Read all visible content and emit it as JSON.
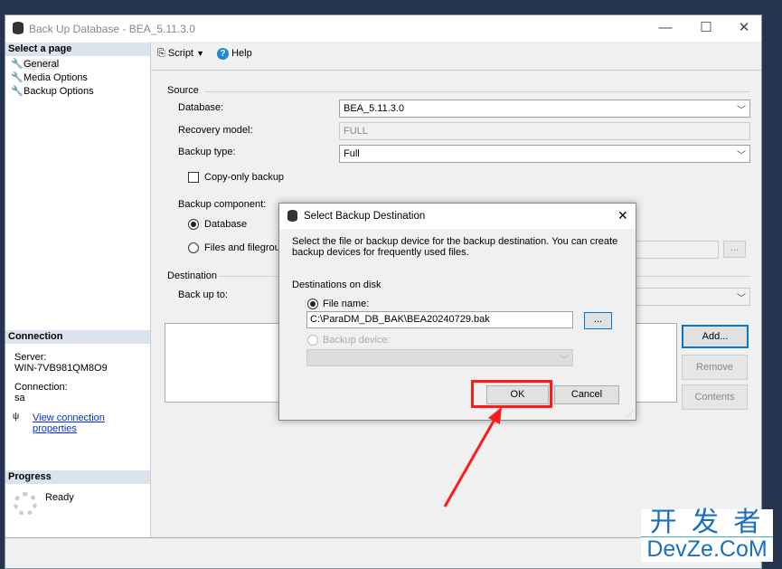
{
  "window": {
    "title": "Back Up Database - BEA_5.11.3.0",
    "icon": "database-icon"
  },
  "left": {
    "select_page": "Select a page",
    "pages": [
      {
        "label": "General",
        "icon": "wrench-icon"
      },
      {
        "label": "Media Options",
        "icon": "wrench-icon"
      },
      {
        "label": "Backup Options",
        "icon": "wrench-icon"
      }
    ],
    "connection_header": "Connection",
    "server_label": "Server:",
    "server": "WIN-7VB981QM8O9",
    "connection_label": "Connection:",
    "connection": "sa",
    "view_props": "View connection properties",
    "progress_header": "Progress",
    "progress_status": "Ready"
  },
  "toolbar": {
    "script": "Script",
    "help": "Help"
  },
  "source": {
    "legend": "Source",
    "database_label": "Database:",
    "database": "BEA_5.11.3.0",
    "recovery_label": "Recovery model:",
    "recovery": "FULL",
    "type_label": "Backup type:",
    "type": "Full",
    "copy_only": "Copy-only backup",
    "component_label": "Backup component:",
    "comp_database": "Database",
    "comp_files": "Files and filegroups:",
    "browse": "..."
  },
  "destination": {
    "legend": "Destination",
    "backup_to_label": "Back up to:",
    "add": "Add...",
    "remove": "Remove",
    "contents": "Contents"
  },
  "dialog": {
    "title": "Select Backup Destination",
    "description": "Select the file or backup device for the backup destination. You can create backup devices for frequently used files.",
    "disk_label": "Destinations on disk",
    "file_name_label": "File name:",
    "file_name": "C:\\ParaDM_DB_BAK\\BEA20240729.bak",
    "browse": "...",
    "device_label": "Backup device:",
    "ok": "OK",
    "cancel": "Cancel"
  },
  "annotation": {
    "color": "#ff1a1a"
  },
  "watermark": {
    "line1": "开 发 者",
    "line2": "DevZe.CoM"
  }
}
